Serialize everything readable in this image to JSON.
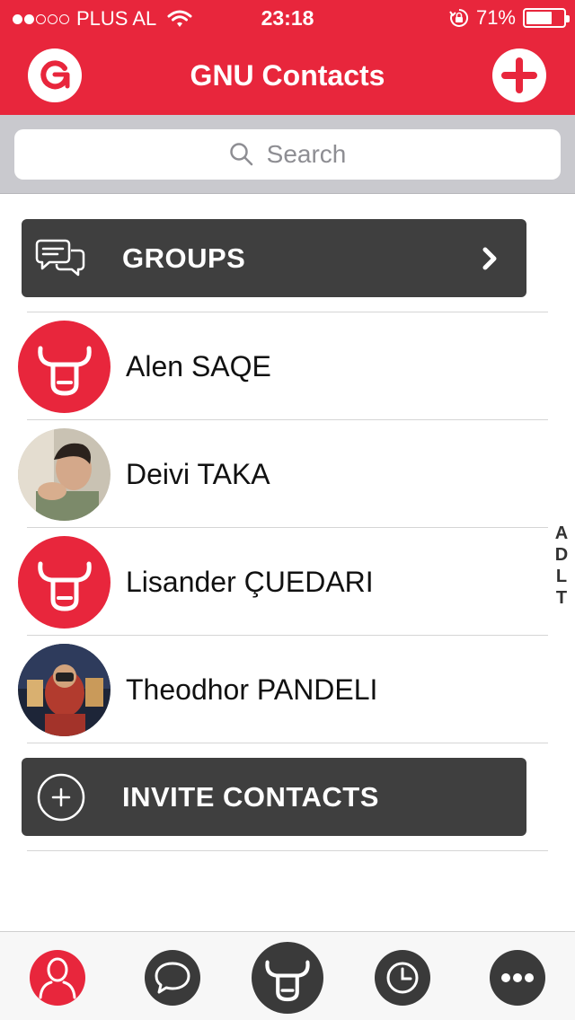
{
  "status_bar": {
    "carrier": "PLUS AL",
    "time": "23:18",
    "battery_percent": "71%",
    "battery_level": 0.71,
    "signal_bars_filled": 2,
    "signal_bars_total": 5
  },
  "nav": {
    "title": "GNU Contacts",
    "left_icon": "refresh-icon",
    "right_icon": "add-icon"
  },
  "search": {
    "placeholder": "Search"
  },
  "groups_button": {
    "label": "GROUPS",
    "icon": "chat-bubbles-icon"
  },
  "contacts": [
    {
      "name": "Alen SAQE",
      "avatar": "bull-logo"
    },
    {
      "name": "Deivi TAKA",
      "avatar": "photo"
    },
    {
      "name": "Lisander ÇUEDARI",
      "avatar": "bull-logo"
    },
    {
      "name": "Theodhor PANDELI",
      "avatar": "photo"
    }
  ],
  "invite_button": {
    "label": "INVITE CONTACTS",
    "icon": "plus-circle-icon"
  },
  "section_index": [
    "A",
    "D",
    "L",
    "T"
  ],
  "tabbar": {
    "tabs": [
      "contacts-tab",
      "chats-tab",
      "home-tab",
      "history-tab",
      "more-tab"
    ],
    "active": "contacts-tab"
  },
  "colors": {
    "brand_red": "#e8263c",
    "dark_button": "#3f3f3f"
  }
}
